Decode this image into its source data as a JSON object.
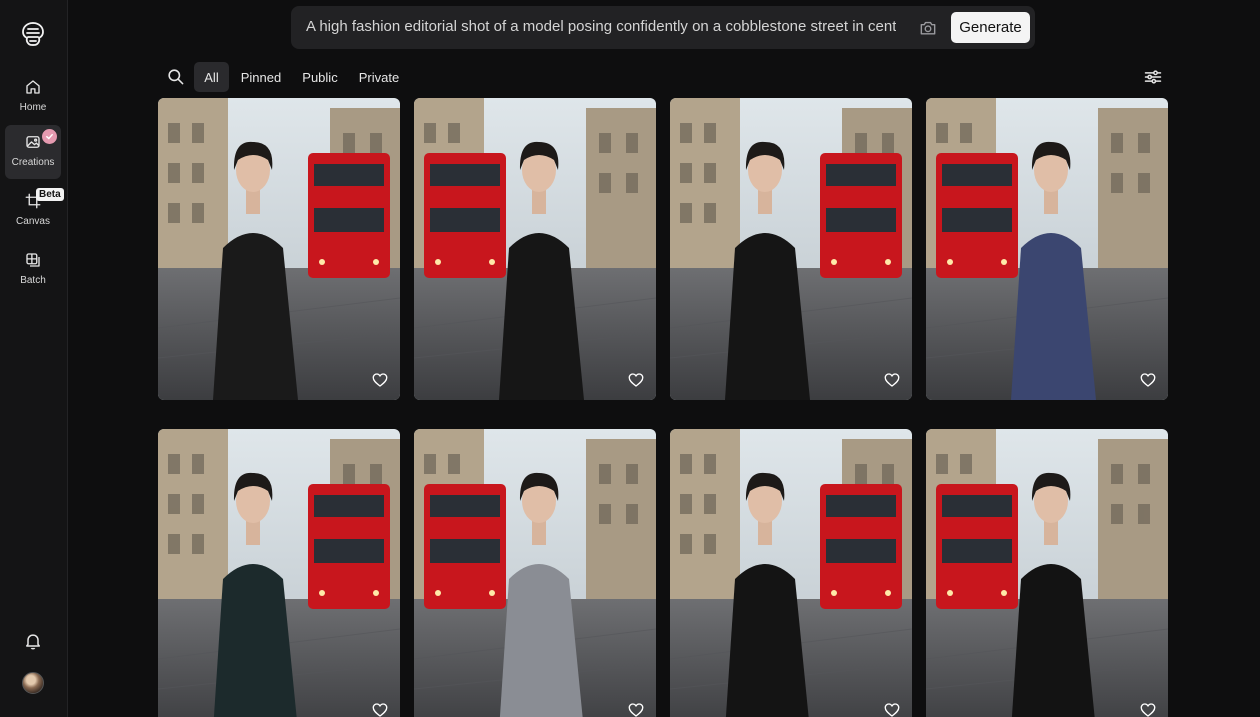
{
  "prompt": {
    "text": "A high fashion editorial shot of a model posing confidently on a cobblestone street in central",
    "generate_label": "Generate"
  },
  "sidebar": {
    "items": [
      {
        "label": "Home"
      },
      {
        "label": "Creations"
      },
      {
        "label": "Canvas"
      },
      {
        "label": "Batch"
      }
    ],
    "beta_label": "Beta"
  },
  "filters": {
    "tabs": [
      {
        "label": "All"
      },
      {
        "label": "Pinned"
      },
      {
        "label": "Public"
      },
      {
        "label": "Private"
      }
    ],
    "active_tab": "All"
  },
  "colors": {
    "background": "#0e0e0f",
    "sidebar": "#141415",
    "accent_badge": "#e59ab0",
    "bus_red": "#c8161d"
  },
  "gallery": {
    "images": [
      {
        "outfit": "black leather trench coat",
        "outfit_color": "#1a1a1a"
      },
      {
        "outfit": "black dress with bell sleeves",
        "outfit_color": "#161616"
      },
      {
        "outfit": "black asymmetric sculptural dress",
        "outfit_color": "#151515"
      },
      {
        "outfit": "navy satin dress",
        "outfit_color": "#3b4670"
      },
      {
        "outfit": "dark teal draped top",
        "outfit_color": "#1c2a2c"
      },
      {
        "outfit": "silver metallic off-shoulder gown",
        "outfit_color": "#8a8d94"
      },
      {
        "outfit": "black one-shoulder gown",
        "outfit_color": "#141414"
      },
      {
        "outfit": "black off-shoulder gown",
        "outfit_color": "#131313"
      }
    ]
  }
}
